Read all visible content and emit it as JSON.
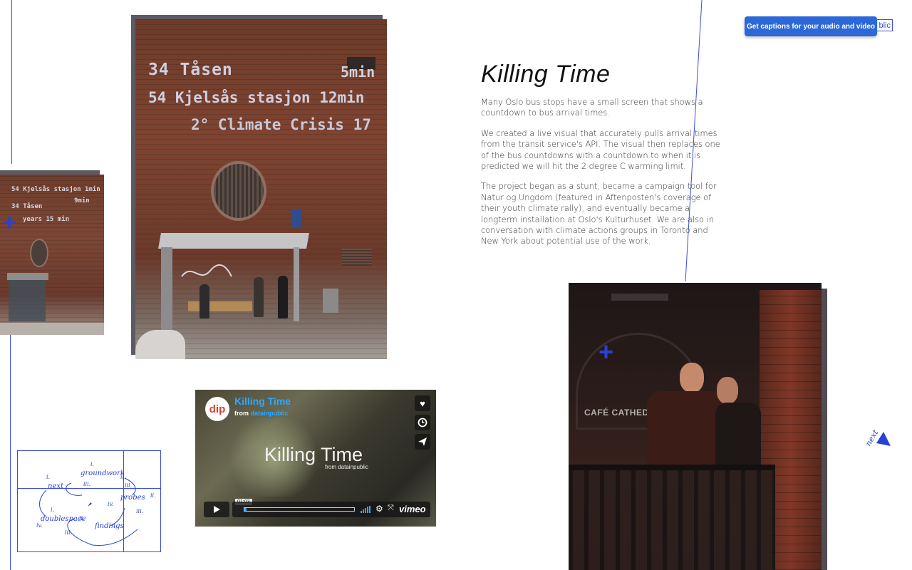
{
  "article": {
    "title": "Killing Time",
    "paragraphs": [
      "Many Oslo bus stops have a small screen that shows a countdown to bus arrival times.",
      "We created a live visual that accurately pulls arrival times from the transit service's API. The visual then replaces one of the bus countdowns with a countdown to when it is predicted we will hit the 2 degree C warming limit.",
      "The project began as a stunt, became a campaign tool for Natur og Ungdom (featured in Aftenposten's coverage of their youth climate rally), and eventually became a longterm installation at Oslo's Kulturhuset. We are also in conversation with climate actions groups in Toronto and New York about potential use of the work."
    ]
  },
  "caption_button": {
    "label": "Get captions for your audio and video",
    "behind_text": "blic"
  },
  "main_photo": {
    "lines": [
      "34 Tåsen",
      "5min",
      "54 Kjelsås stasjon 12min",
      "2° Climate Crisis 17"
    ]
  },
  "left_photo": {
    "lines": [
      "54 Kjelsås stasjon 1min",
      "34 Tåsen",
      "9min",
      "years 15 min"
    ]
  },
  "cafe_sign": "CAFÉ CATHEDRAL",
  "video": {
    "title": "Killing Time",
    "from_prefix": "from",
    "from_user": "datainpublic",
    "logo": "dip",
    "center_title": "Killing Time",
    "center_sub": "from datainpublic",
    "timecode": "01:03",
    "brand": "vimeo",
    "progress": 0.02
  },
  "next_arrow": {
    "label": "next"
  },
  "nav_map": {
    "words": [
      "groundwork",
      "next",
      "probes",
      "doublespace",
      "findings"
    ],
    "numerals": [
      "i.",
      "ii.",
      "iii.",
      "i.",
      "iii.",
      "ii.",
      "iv.",
      "iii.",
      "i.",
      "ii.",
      "iv.",
      "iii.",
      "ii."
    ]
  },
  "colors": {
    "accent": "#2742d8",
    "caption_button": "#2d68d8",
    "vimeo_blue": "#2ea8ff"
  }
}
